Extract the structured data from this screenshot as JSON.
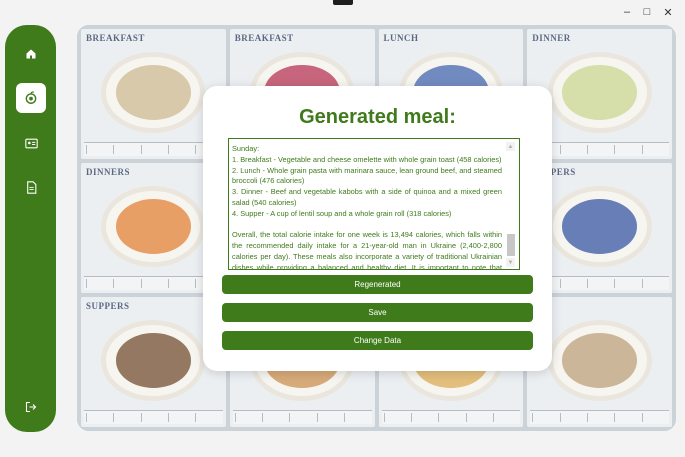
{
  "window": {
    "minimize_glyph": "–",
    "maximize_glyph": "□",
    "close_glyph": "✕"
  },
  "sidebar": {
    "items": [
      {
        "name": "home-icon",
        "active": false
      },
      {
        "name": "meal-generator-icon",
        "active": true
      },
      {
        "name": "id-card-icon",
        "active": false
      },
      {
        "name": "document-icon",
        "active": false
      },
      {
        "name": "logout-icon",
        "active": false
      }
    ]
  },
  "background": {
    "tiles": [
      {
        "label": "BREAKFAST",
        "food_color": "#c9b48a"
      },
      {
        "label": "BREAKFAST",
        "food_color": "#b02a4a"
      },
      {
        "label": "LUNCH",
        "food_color": "#3b5fa8"
      },
      {
        "label": "DINNER",
        "food_color": "#c7d18a"
      },
      {
        "label": "DINNERS",
        "food_color": "#e07a2c"
      },
      {
        "label": "",
        "food_color": "#c4ccd4"
      },
      {
        "label": "",
        "food_color": "#c4ccd4"
      },
      {
        "label": "SUPPERS",
        "food_color": "#2f4d9a"
      },
      {
        "label": "SUPPERS",
        "food_color": "#6b4424"
      },
      {
        "label": "",
        "food_color": "#c68a46"
      },
      {
        "label": "",
        "food_color": "#d8a54a"
      },
      {
        "label": "",
        "food_color": "#b89a72"
      }
    ]
  },
  "modal": {
    "title": "Generated meal:",
    "text": {
      "day_heading": "Sunday:",
      "line1": "1. Breakfast - Vegetable and cheese omelette with whole grain toast (458 calories)",
      "line2": "2. Lunch - Whole grain pasta with marinara sauce, lean ground beef, and steamed broccoli (476 calories)",
      "line3": "3. Dinner - Beef and vegetable kabobs with a side of quinoa and a mixed green salad (540 calories)",
      "line4": "4. Supper - A cup of lentil soup and a whole grain roll (318 calories)",
      "summary": "Overall, the total calorie intake for one week is 13,494 calories, which falls within the recommended daily intake for a 21-year-old man in Ukraine (2,400-2,800 calories per day). These meals also incorporate a variety of traditional Ukrainian dishes while providing a balanced and healthy diet. It is important to note that portion sizes should be adjusted based on individual needs and daily physical activity."
    },
    "buttons": {
      "regenerated": "Regenerated",
      "save": "Save",
      "change_data": "Change Data"
    }
  },
  "colors": {
    "accent": "#3f7b1b",
    "modal_bg": "#ffffff"
  }
}
